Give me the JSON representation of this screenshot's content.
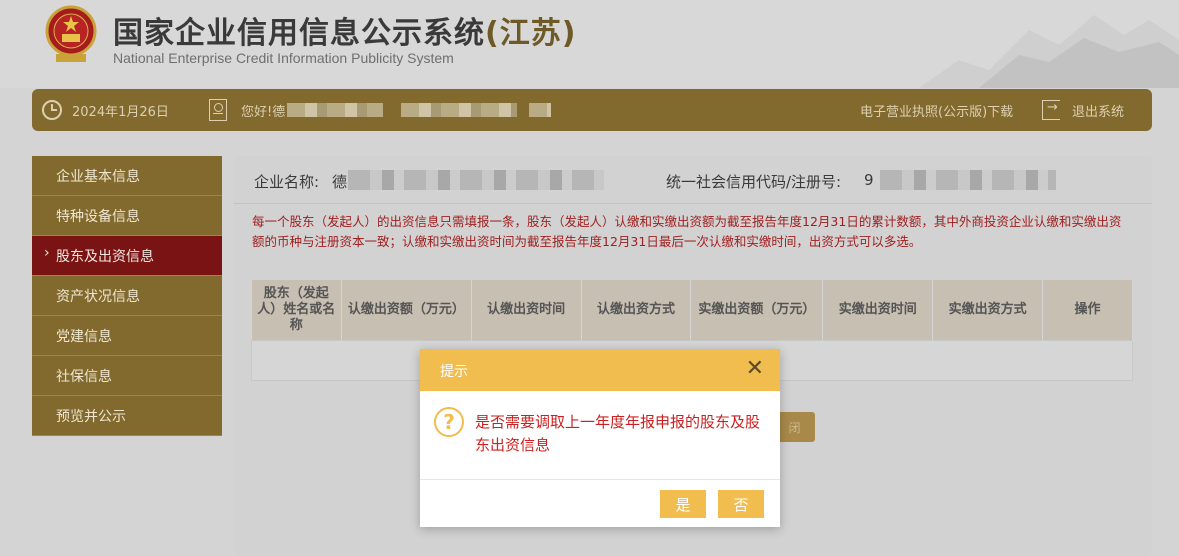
{
  "header": {
    "title_main": "国家企业信用信息公示系统",
    "title_province": "(江苏)",
    "title_en": "National Enterprise Credit Information Publicity System"
  },
  "topbar": {
    "date": "2024年1月26日",
    "greeting": "您好!德",
    "license_download": "电子营业执照(公示版)下载",
    "logout": "退出系统"
  },
  "sidebar": {
    "items": [
      {
        "label": "企业基本信息"
      },
      {
        "label": "特种设备信息"
      },
      {
        "label": "股东及出资信息"
      },
      {
        "label": "资产状况信息"
      },
      {
        "label": "党建信息"
      },
      {
        "label": "社保信息"
      },
      {
        "label": "预览并公示"
      }
    ]
  },
  "main": {
    "company_label": "企业名称:",
    "company_value_visible": "德",
    "code_label": "统一社会信用代码/注册号:",
    "code_value_visible": "9",
    "notice": "每一个股东（发起人）的出资信息只需填报一条，股东（发起人）认缴和实缴出资额为截至报告年度12月31日的累计数额，其中外商投资企业认缴和实缴出资额的币种与注册资本一致；认缴和实缴出资时间为截至报告年度12月31日最后一次认缴和实缴时间，出资方式可以多选。",
    "table_headers": [
      "股东（发起人）姓名或名称",
      "认缴出资额（万元）",
      "认缴出资时间",
      "认缴出资方式",
      "实缴出资额（万元）",
      "实缴出资时间",
      "实缴出资方式",
      "操作"
    ],
    "hidden_button_text": "闭"
  },
  "dialog": {
    "title": "提示",
    "close_glyph": "✕",
    "icon_glyph": "?",
    "message": "是否需要调取上一年度年报申报的股东及股东出资信息",
    "yes_label": "是",
    "no_label": "否"
  }
}
